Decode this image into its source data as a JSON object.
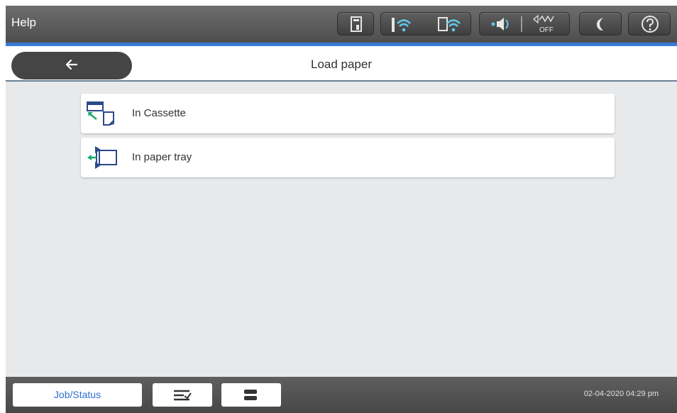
{
  "topbar": {
    "title": "Help",
    "icons": [
      "ink-icon",
      "wifi-icon",
      "wifi-direct-icon",
      "sound-icon",
      "quiet-mode-off-icon",
      "sleep-icon",
      "help-icon"
    ],
    "quiet_mode_label": "OFF"
  },
  "header": {
    "title": "Load paper",
    "back_icon": "back-arrow-icon"
  },
  "list": {
    "items": [
      {
        "label": "In Cassette",
        "icon": "cassette-icon"
      },
      {
        "label": "In paper tray",
        "icon": "paper-tray-icon"
      }
    ]
  },
  "bottombar": {
    "job_status_label": "Job/Status",
    "datetime": "02-04-2020 04:29 pm",
    "button2_icon": "collapse-icon",
    "button3_icon": "printer-status-icon"
  },
  "colors": {
    "accent": "#3a7bd5",
    "topbar": "#555555",
    "job_status_text": "#2f6fd1",
    "icon_green": "#1aa86b",
    "icon_blue": "#2b4a8c"
  }
}
